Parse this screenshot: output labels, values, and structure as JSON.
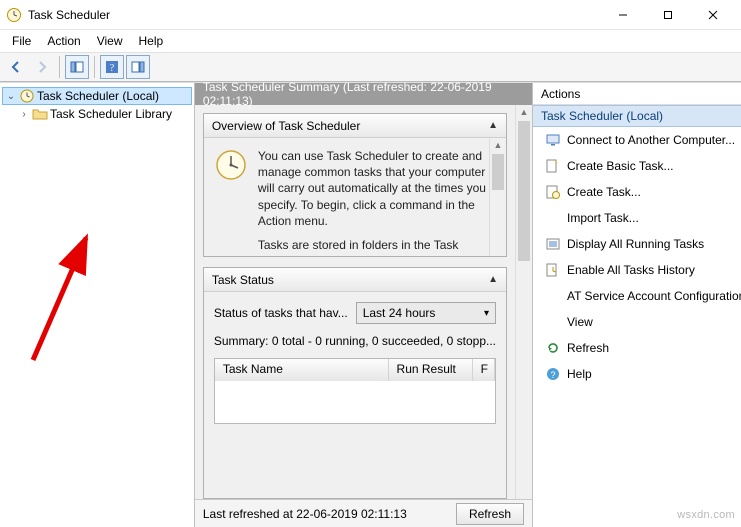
{
  "window": {
    "title": "Task Scheduler"
  },
  "menu": [
    "File",
    "Action",
    "View",
    "Help"
  ],
  "tree": {
    "root": "Task Scheduler (Local)",
    "child": "Task Scheduler Library"
  },
  "summary": {
    "header": "Task Scheduler Summary (Last refreshed: 22-06-2019 02:11:13)",
    "overview_title": "Overview of Task Scheduler",
    "overview_text1": "You can use Task Scheduler to create and manage common tasks that your computer will carry out automatically at the times you specify. To begin, click a command in the Action menu.",
    "overview_text2": "Tasks are stored in folders in the Task"
  },
  "task_status": {
    "title": "Task Status",
    "label": "Status of tasks that hav...",
    "range": "Last 24 hours",
    "summary_line": "Summary: 0 total - 0 running, 0 succeeded, 0 stopp...",
    "col1": "Task Name",
    "col2": "Run Result",
    "col3": "F"
  },
  "footer": {
    "text": "Last refreshed at 22-06-2019 02:11:13",
    "refresh": "Refresh"
  },
  "actions": {
    "title": "Actions",
    "section": "Task Scheduler (Local)",
    "items": [
      "Connect to Another Computer...",
      "Create Basic Task...",
      "Create Task...",
      "Import Task...",
      "Display All Running Tasks",
      "Enable All Tasks History",
      "AT Service Account Configuration",
      "View",
      "Refresh",
      "Help"
    ]
  },
  "watermark": "wsxdn.com"
}
